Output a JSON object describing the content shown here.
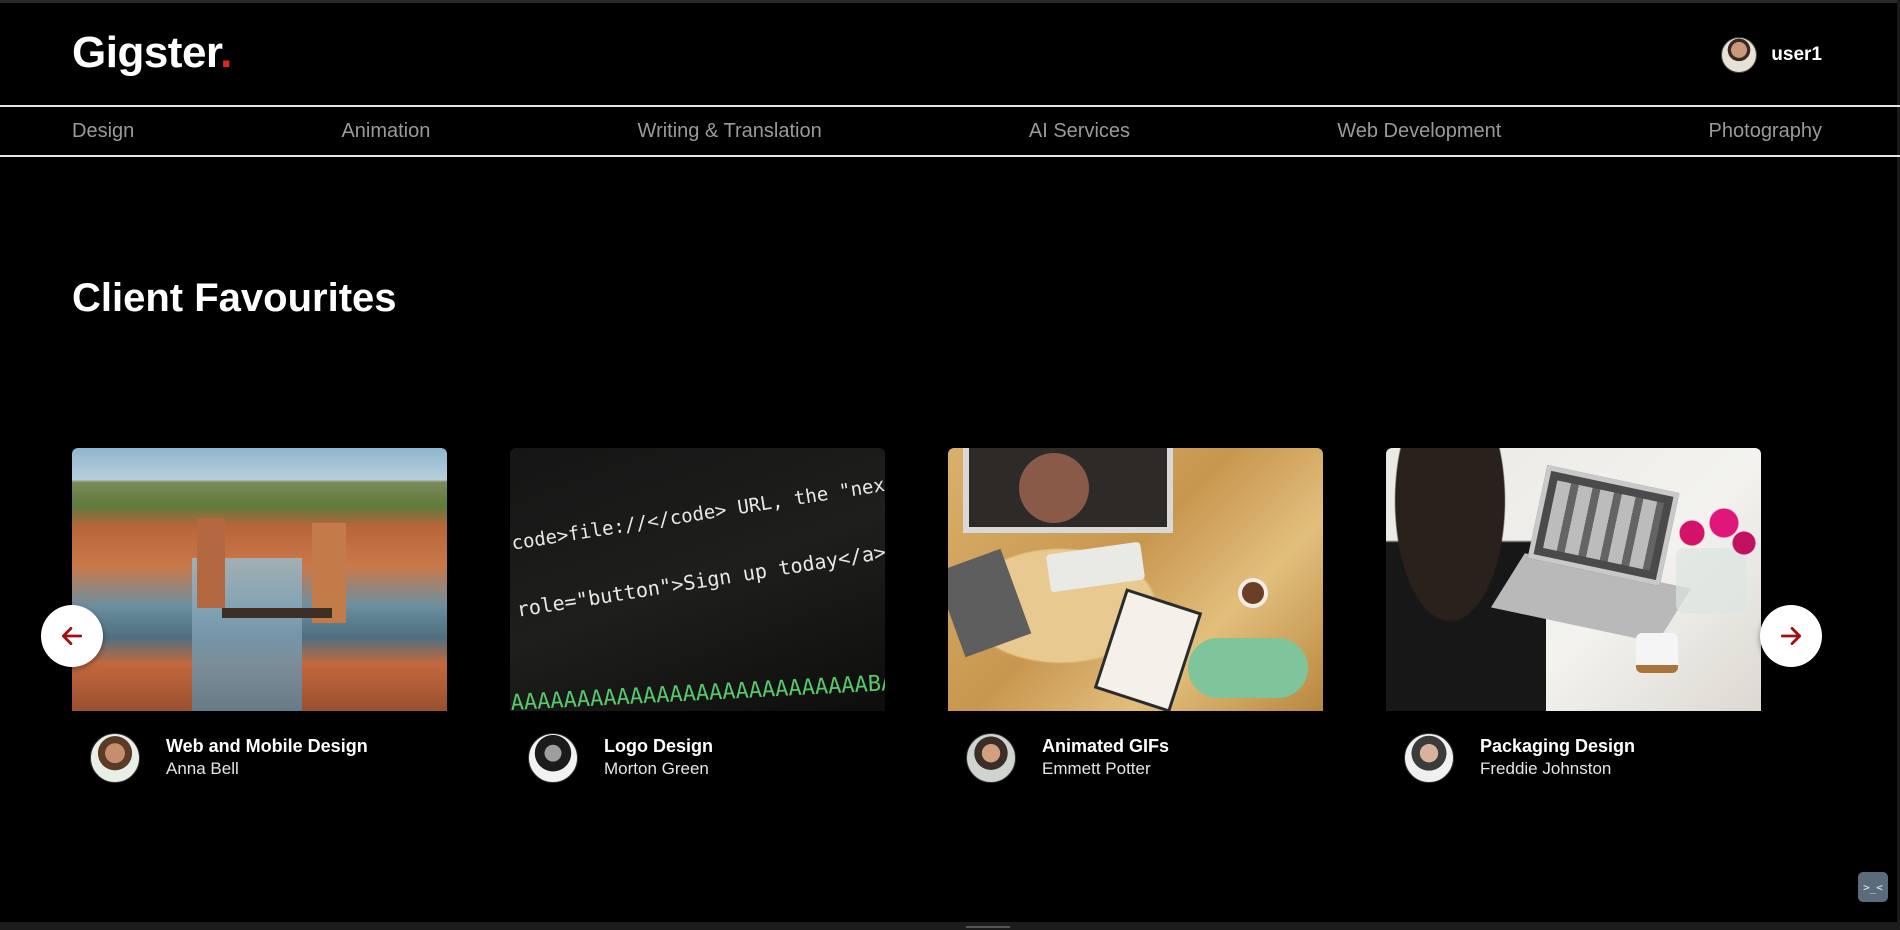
{
  "header": {
    "logo_text": "Gigster",
    "logo_dot": ".",
    "user": {
      "name": "user1"
    }
  },
  "nav": {
    "items": [
      {
        "label": "Design"
      },
      {
        "label": "Animation"
      },
      {
        "label": "Writing & Translation"
      },
      {
        "label": "AI Services"
      },
      {
        "label": "Web Development"
      },
      {
        "label": "Photography"
      }
    ]
  },
  "section": {
    "title": "Client Favourites"
  },
  "cards": [
    {
      "title": "Web and Mobile Design",
      "author": "Anna Bell",
      "image": "venice-canal-photo"
    },
    {
      "title": "Logo Design",
      "author": "Morton Green",
      "image": "code-screen-photo",
      "code_lines": [
        "code>file://</code> URL, the \"next\" ",
        " role=\"button\">Sign up today</a></p>",
        "AAAAAAAAAAAAAAAAAAAAAAAAAAABAAEAAAIC"
      ]
    },
    {
      "title": "Animated GIFs",
      "author": "Emmett Potter",
      "image": "desk-top-view-photo"
    },
    {
      "title": "Packaging Design",
      "author": "Freddie Johnston",
      "image": "woman-laptop-photo"
    }
  ],
  "carousel": {
    "prev_icon": "arrow-left-icon",
    "next_icon": "arrow-right-icon",
    "arrow_color": "#a10e12"
  },
  "widget": {
    "label": ">_<"
  },
  "colors": {
    "accent": "#e0261f",
    "background": "#000000",
    "nav_text": "#9a9a9a"
  }
}
